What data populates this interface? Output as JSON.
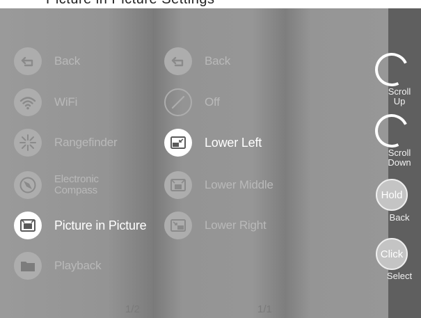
{
  "caption": "Picture in Picture Settings",
  "menu1": {
    "items": [
      {
        "label": "Back",
        "icon": "back-arrow-icon"
      },
      {
        "label": "WiFi",
        "icon": "wifi-icon"
      },
      {
        "label": "Rangefinder",
        "icon": "rangefinder-icon"
      },
      {
        "label_line1": "Electronic",
        "label_line2": "Compass",
        "icon": "compass-icon"
      },
      {
        "label": "Picture in Picture",
        "icon": "picture-in-picture-icon",
        "selected": true
      },
      {
        "label": "Playback",
        "icon": "playback-folder-icon"
      }
    ],
    "page": "1/2"
  },
  "menu2": {
    "items": [
      {
        "label": "Back",
        "icon": "back-arrow-icon"
      },
      {
        "label": "Off",
        "icon": "off-icon"
      },
      {
        "label": "Lower Left",
        "icon": "pip-lower-left-icon",
        "selected": true
      },
      {
        "label": "Lower Middle",
        "icon": "pip-lower-middle-icon"
      },
      {
        "label": "Lower Right",
        "icon": "pip-lower-right-icon"
      }
    ],
    "page": "1/1"
  },
  "controls": {
    "scroll_up": {
      "line1": "Scroll",
      "line2": "Up"
    },
    "scroll_down": {
      "line1": "Scroll",
      "line2": "Down"
    },
    "hold": {
      "button": "Hold",
      "label": "Back"
    },
    "click": {
      "button": "Click",
      "label": "Select"
    }
  },
  "colors": {
    "panel": "#959595",
    "rail": "#5f5f5f",
    "icon_inactive": "#adadad",
    "icon_active": "#ffffff",
    "text_inactive": "#b9b9b9",
    "text_active": "#ffffff"
  }
}
